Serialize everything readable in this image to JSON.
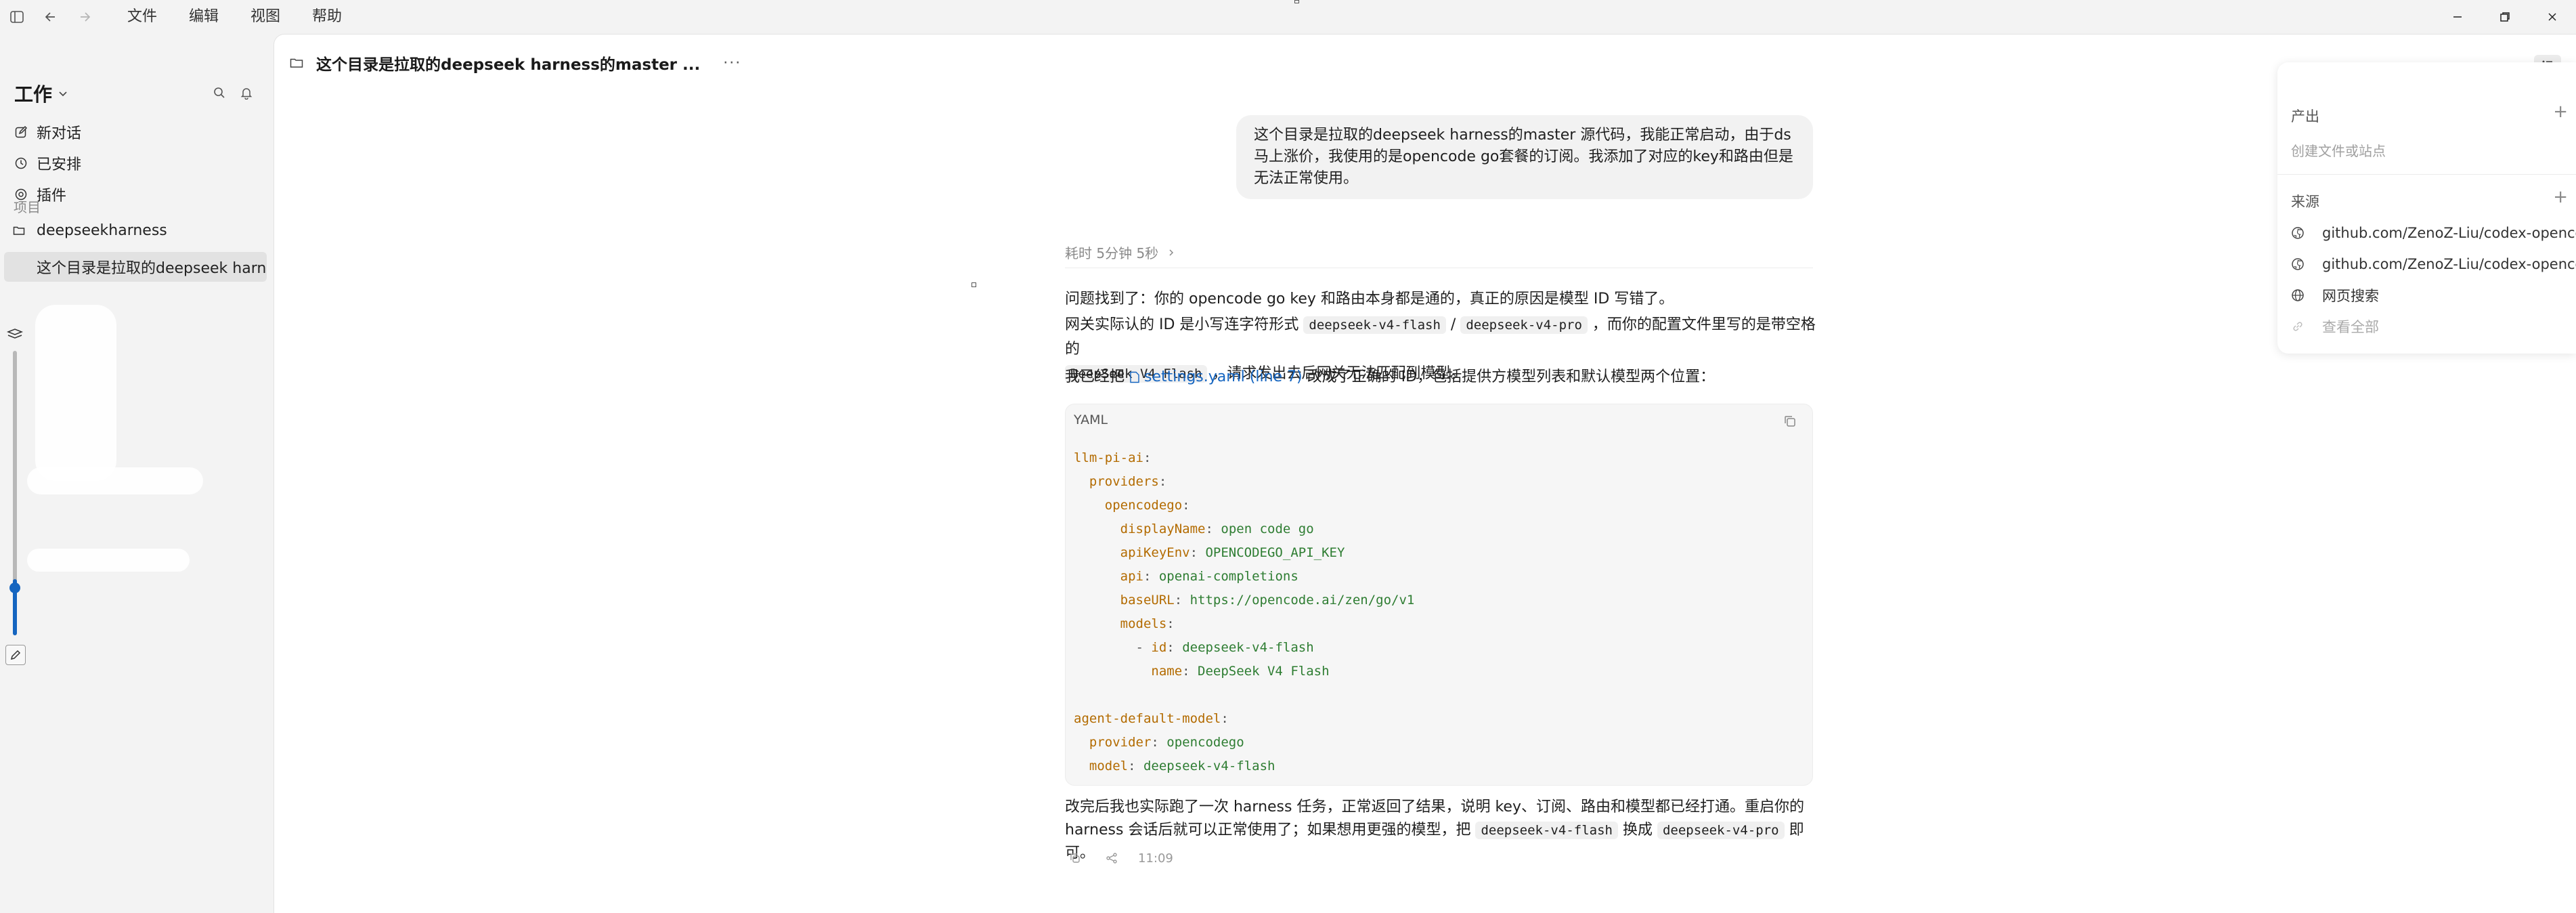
{
  "menu": {
    "file": "文件",
    "edit": "编辑",
    "view": "视图",
    "help": "帮助"
  },
  "sidebar": {
    "workspace_title": "工作",
    "nav": {
      "new_chat": "新对话",
      "scheduled": "已安排",
      "plugins": "插件"
    },
    "projects_label": "项目",
    "project_name": "deepseekharness",
    "thread_title": "这个目录是拉取的deepseek harness的master 源代码"
  },
  "thread": {
    "title": "这个目录是拉取的deepseek harness的master ...",
    "more": "···"
  },
  "user_message": "这个目录是拉取的deepseek harness的master 源代码，我能正常启动，由于ds马上涨价，我使用的是opencode go套餐的订阅。我添加了对应的key和路由但是无法正常使用。",
  "assistant": {
    "elapsed": "耗时 5分钟 5秒",
    "p1": "问题找到了：你的 opencode go key 和路由本身都是通的，真正的原因是模型 ID 写错了。",
    "p2_a": "网关实际认的 ID 是小写连字符形式",
    "code_flash": "deepseek-v4-flash",
    "slash": "/",
    "code_pro": "deepseek-v4-pro",
    "p2_b": "，而你的配置文件里写的是带空格的",
    "code_display": "DeepSeek V4 Flash",
    "p2_c": "，请求发出去后网关无法匹配到模型。",
    "p3_a": "我已经把",
    "file_link": "settings.yaml (line 7)",
    "p3_b": "改成了正确的 ID，包括提供方模型列表和默认模型两个位置：",
    "code_lang": "YAML",
    "code": {
      "l1_key": "llm-pi-ai",
      "l2_key": "providers",
      "l3_key": "opencodego",
      "l4_key": "displayName",
      "l4_val": "open code go",
      "l5_key": "apiKeyEnv",
      "l5_val": "OPENCODEGO_API_KEY",
      "l6_key": "api",
      "l6_val": "openai-completions",
      "l7_key": "baseURL",
      "l7_val": "https://opencode.ai/zen/go/v1",
      "l8_key": "models",
      "l9_key": "id",
      "l9_val": "deepseek-v4-flash",
      "l10_key": "name",
      "l10_val": "DeepSeek V4 Flash",
      "l11_key": "agent-default-model",
      "l12_key": "provider",
      "l12_val": "opencodego",
      "l13_key": "model",
      "l13_val": "deepseek-v4-flash"
    },
    "p4": "改完后我也实际跑了一次 harness 任务，正常返回了结果，说明 key、订阅、路由和模型都已经打通。重启你的 harness 会话后就可以正常使用了；如果想用更强的模型，把",
    "p4_code_a": "deepseek-v4-flash",
    "p4_mid": "换成",
    "p4_code_b": "deepseek-v4-pro",
    "p4_end": "即可。",
    "timestamp": "11:09"
  },
  "side_panel": {
    "outputs_label": "产出",
    "outputs_hint": "创建文件或站点",
    "sources_label": "来源",
    "sources": [
      "github.com/ZenoZ-Liu/codex-opencode",
      "github.com/ZenoZ-Liu/codex-opencode"
    ],
    "web_search": "网页搜索",
    "view_all": "查看全部",
    "plus": "+"
  },
  "colors": {
    "accent": "#1565c0",
    "code_key": "#b36b00",
    "code_value": "#2e7d32"
  }
}
